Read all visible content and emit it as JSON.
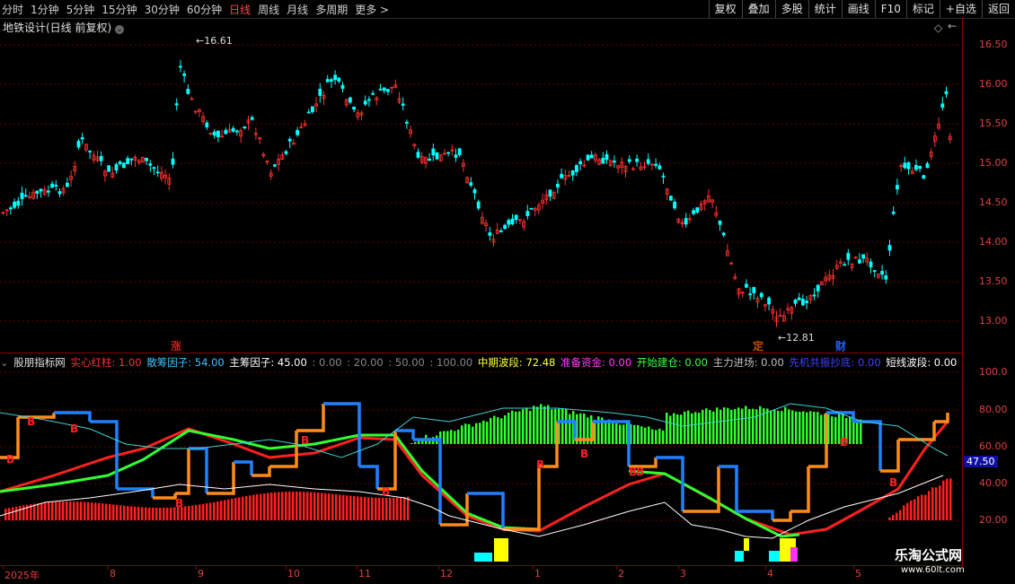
{
  "toolbar": {
    "periods": [
      "分时",
      "1分钟",
      "5分钟",
      "15分钟",
      "30分钟",
      "60分钟",
      "日线",
      "周线",
      "月线",
      "多周期",
      "更多"
    ],
    "active": "日线",
    "right_buttons": [
      "复权",
      "叠加",
      "多股",
      "统计",
      "画线",
      "F10",
      "标记",
      "+自选",
      "返回"
    ]
  },
  "stock": {
    "title": "地铁设计(日线 前复权)",
    "high_label": "16.61",
    "low_label": "12.81",
    "markers": [
      "涨",
      "定",
      "财"
    ]
  },
  "price_axis": [
    "16.50",
    "16.00",
    "15.50",
    "15.00",
    "14.50",
    "14.00",
    "13.50",
    "13.00"
  ],
  "indicator": {
    "name": "股朋指标网",
    "fields": [
      {
        "label": "实心红柱:",
        "value": "1.00",
        "color": "#ff3030"
      },
      {
        "label": "散筹因子:",
        "value": "54.00",
        "color": "#40c0ff"
      },
      {
        "label": "主筹因子:",
        "value": "45.00",
        "color": "#ffffff"
      },
      {
        "label": ":",
        "value": "0.00",
        "color": "#888888"
      },
      {
        "label": ":",
        "value": "20.00",
        "color": "#888888"
      },
      {
        "label": ":",
        "value": "50.00",
        "color": "#888888"
      },
      {
        "label": ":",
        "value": "100.00",
        "color": "#888888"
      },
      {
        "label": "中期波段:",
        "value": "72.48",
        "color": "#ffff40"
      },
      {
        "label": "准备资金:",
        "value": "0.00",
        "color": "#ff40ff"
      },
      {
        "label": "开始建仓:",
        "value": "0.00",
        "color": "#40ff40"
      },
      {
        "label": "主力进场:",
        "value": "0.00",
        "color": "#c0c0c0"
      },
      {
        "label": "先机共振抄底:",
        "value": "0.00",
        "color": "#4040ff"
      },
      {
        "label": "短线波段:",
        "value": "0.00",
        "color": "#ffffff"
      },
      {
        "label": ":",
        "value": "72.4",
        "color": "#40ff40"
      }
    ],
    "axis": [
      "100.0",
      "80.00",
      "60.00",
      "40.00",
      "20.00"
    ],
    "current_value": "47.50",
    "b_markers": [
      "B",
      "B",
      "B",
      "B",
      "B",
      "B",
      "B",
      "B",
      "B",
      "B",
      "B",
      "B"
    ]
  },
  "date_axis": [
    "2025年",
    "8",
    "9",
    "10",
    "11",
    "12",
    "1",
    "2",
    "3",
    "4",
    "5"
  ],
  "watermark": {
    "name": "乐淘公式网",
    "url": "www.60lt.com"
  },
  "colors": {
    "up": "#ff3030",
    "down": "#00ffff",
    "grid": "#8b0000"
  }
}
